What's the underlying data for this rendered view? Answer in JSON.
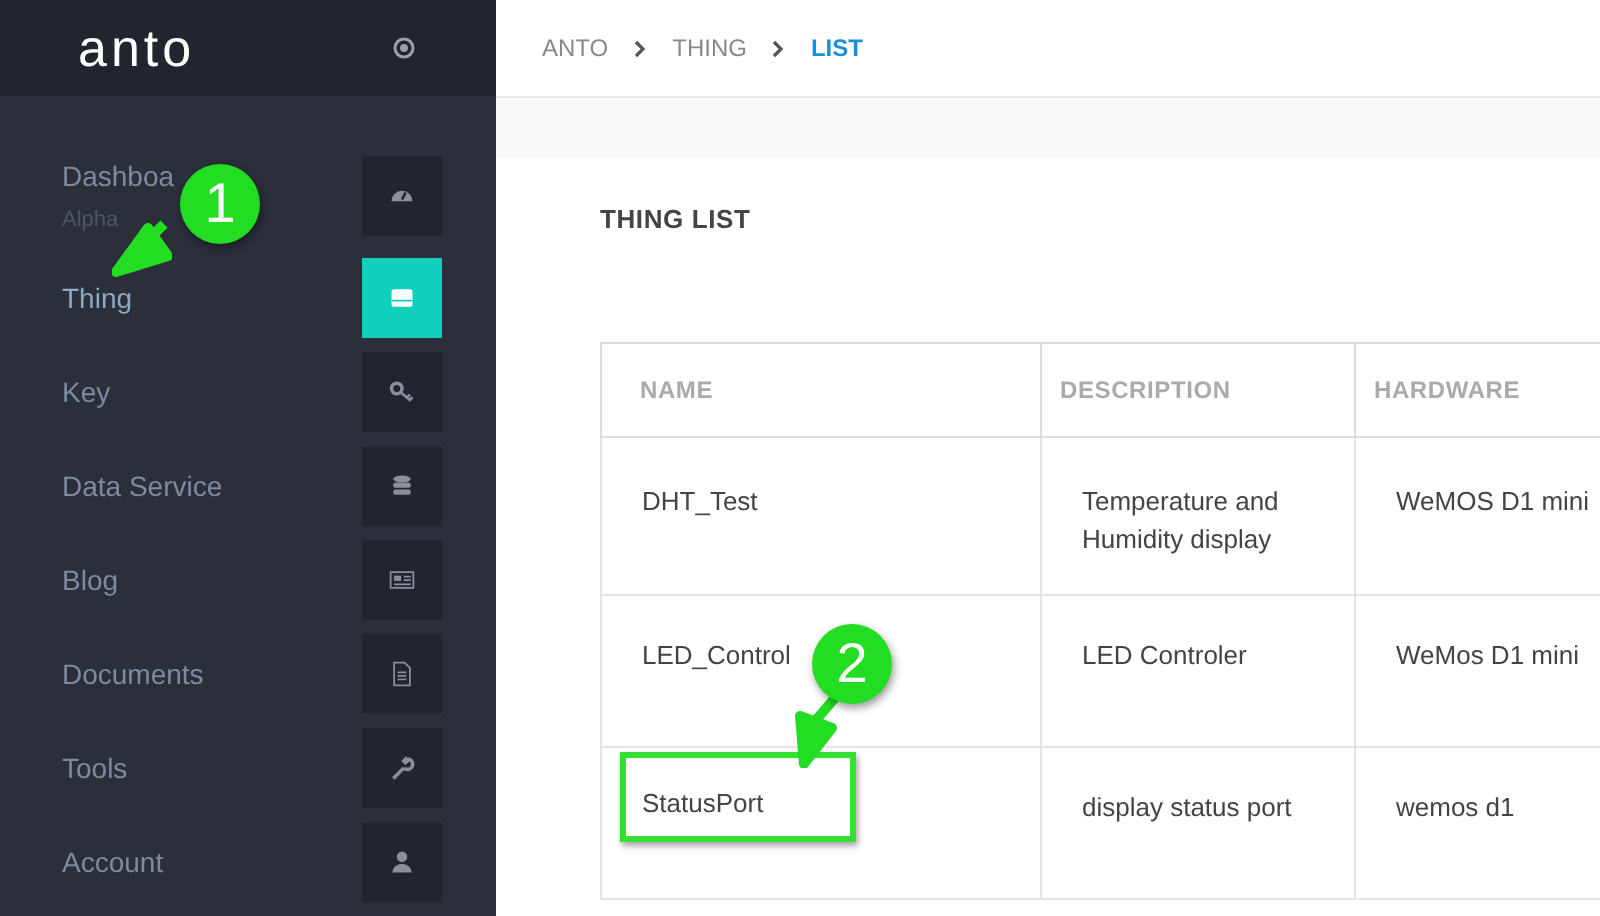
{
  "sidebar": {
    "logo": "anto",
    "items": [
      {
        "label": "Dashboa",
        "sublabel": "Alpha",
        "selected": false
      },
      {
        "label": "Thing",
        "selected": true
      },
      {
        "label": "Key",
        "selected": false
      },
      {
        "label": "Data Service",
        "selected": false
      },
      {
        "label": "Blog",
        "selected": false
      },
      {
        "label": "Documents",
        "selected": false
      },
      {
        "label": "Tools",
        "selected": false
      },
      {
        "label": "Account",
        "selected": false
      }
    ]
  },
  "breadcrumb": [
    {
      "label": "ANTO",
      "selected": false
    },
    {
      "label": "THING",
      "selected": false
    },
    {
      "label": "LIST",
      "selected": true
    }
  ],
  "section_title": "THING LIST",
  "table": {
    "columns": [
      "NAME",
      "DESCRIPTION",
      "HARDWARE"
    ],
    "rows": [
      {
        "cells": [
          "DHT_Test",
          "Temperature and Humidity display",
          "WeMOS D1 mini"
        ],
        "highlighted": false
      },
      {
        "cells": [
          "LED_Control",
          "LED Controler",
          "WeMos D1 mini"
        ],
        "highlighted": false
      },
      {
        "cells": [
          "StatusPort",
          "display status port",
          "wemos d1"
        ],
        "highlighted": true
      }
    ]
  },
  "annotations": [
    {
      "number": "1"
    },
    {
      "number": "2"
    }
  ]
}
